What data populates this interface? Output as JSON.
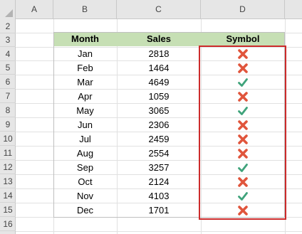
{
  "spreadsheet": {
    "columns": [
      "A",
      "B",
      "C",
      "D"
    ],
    "rows": [
      "2",
      "3",
      "4",
      "5",
      "6",
      "7",
      "8",
      "9",
      "10",
      "11",
      "12",
      "13",
      "14",
      "15",
      "16"
    ],
    "table": {
      "headers": {
        "month": "Month",
        "sales": "Sales",
        "symbol": "Symbol"
      },
      "records": [
        {
          "month": "Jan",
          "sales": "2818",
          "symbol": "cross-icon"
        },
        {
          "month": "Feb",
          "sales": "1464",
          "symbol": "cross-icon"
        },
        {
          "month": "Mar",
          "sales": "4649",
          "symbol": "check-icon"
        },
        {
          "month": "Apr",
          "sales": "1059",
          "symbol": "cross-icon"
        },
        {
          "month": "May",
          "sales": "3065",
          "symbol": "check-icon"
        },
        {
          "month": "Jun",
          "sales": "2306",
          "symbol": "cross-icon"
        },
        {
          "month": "Jul",
          "sales": "2459",
          "symbol": "cross-icon"
        },
        {
          "month": "Aug",
          "sales": "2554",
          "symbol": "cross-icon"
        },
        {
          "month": "Sep",
          "sales": "3257",
          "symbol": "check-icon"
        },
        {
          "month": "Oct",
          "sales": "2124",
          "symbol": "cross-icon"
        },
        {
          "month": "Nov",
          "sales": "4103",
          "symbol": "check-icon"
        },
        {
          "month": "Dec",
          "sales": "1701",
          "symbol": "cross-icon"
        }
      ]
    },
    "colors": {
      "header_fill": "#c6dfb4",
      "cross": "#e0553c",
      "check": "#3fa37b",
      "highlight_border": "#cc2b2b"
    }
  }
}
